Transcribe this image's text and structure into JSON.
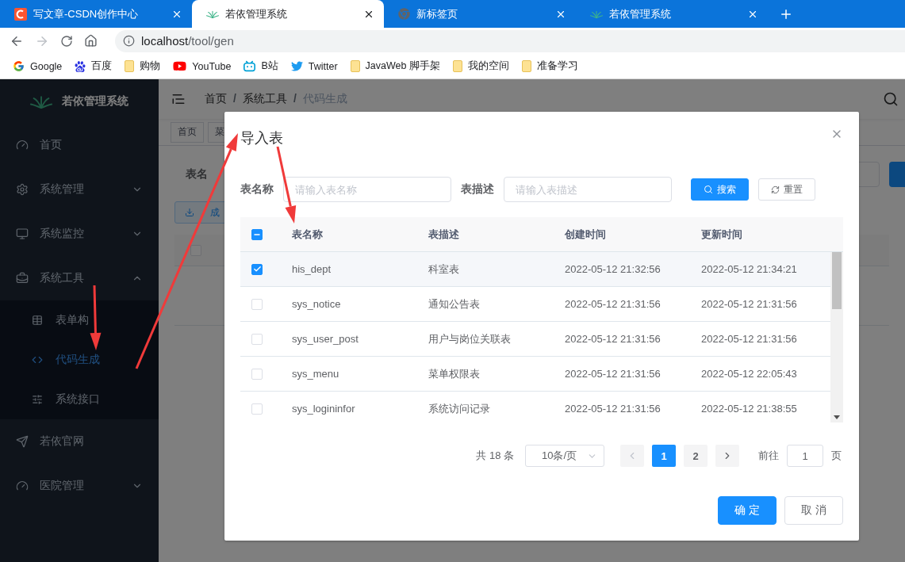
{
  "browser": {
    "tabs": [
      {
        "title": "写文章-CSDN创作中心",
        "kind": "csdn",
        "selected": false
      },
      {
        "title": "若依管理系统",
        "kind": "leaf",
        "selected": true
      },
      {
        "title": "新标签页",
        "kind": "chrome",
        "selected": false
      },
      {
        "title": "若依管理系统",
        "kind": "leaf",
        "selected": false
      }
    ],
    "address": {
      "host": "localhost",
      "path": "/tool/gen"
    },
    "bookmarks": [
      {
        "label": "Google",
        "kind": "google"
      },
      {
        "label": "百度",
        "kind": "baidu"
      },
      {
        "label": "购物",
        "kind": "folder"
      },
      {
        "label": "YouTube",
        "kind": "youtube"
      },
      {
        "label": "B站",
        "kind": "bilibili"
      },
      {
        "label": "Twitter",
        "kind": "twitter"
      },
      {
        "label": "JavaWeb 脚手架",
        "kind": "folder"
      },
      {
        "label": "我的空间",
        "kind": "folder"
      },
      {
        "label": "准备学习",
        "kind": "folder"
      }
    ]
  },
  "sidebar": {
    "title": "若依管理系统",
    "items": [
      {
        "label": "首页",
        "kind": "dashboard"
      },
      {
        "label": "系统管理",
        "kind": "gear",
        "expanded": false
      },
      {
        "label": "系统监控",
        "kind": "monitor",
        "expanded": false
      },
      {
        "label": "系统工具",
        "kind": "toolbox",
        "expanded": true,
        "children": [
          {
            "label": "表单构",
            "kind": "table",
            "selected": false
          },
          {
            "label": "代码生成",
            "kind": "code",
            "selected": true
          },
          {
            "label": "系统接口",
            "kind": "sliders",
            "selected": false
          }
        ]
      },
      {
        "label": "若依官网",
        "kind": "send"
      },
      {
        "label": "医院管理",
        "kind": "dashboard",
        "expanded": false
      }
    ]
  },
  "main": {
    "breadcrumb": [
      "首页",
      "系统工具",
      "代码生成"
    ],
    "breadcrumb_separator": "/",
    "tags": [
      "首页",
      "菜"
    ],
    "query_label": "表名",
    "generate_button": "成",
    "select_all_checked": false
  },
  "dialog": {
    "title": "导入表",
    "filters": [
      {
        "label": "表名称",
        "placeholder": "请输入表名称"
      },
      {
        "label": "表描述",
        "placeholder": "请输入表描述"
      }
    ],
    "search_button": "搜索",
    "reset_button": "重置",
    "table": {
      "header_indeterminate": true,
      "columns": [
        "表名称",
        "表描述",
        "创建时间",
        "更新时间"
      ],
      "rows": [
        {
          "checked": true,
          "cells": [
            "his_dept",
            "科室表",
            "2022-05-12 21:32:56",
            "2022-05-12 21:34:21"
          ]
        },
        {
          "checked": false,
          "cells": [
            "sys_notice",
            "通知公告表",
            "2022-05-12 21:31:56",
            "2022-05-12 21:31:56"
          ]
        },
        {
          "checked": false,
          "cells": [
            "sys_user_post",
            "用户与岗位关联表",
            "2022-05-12 21:31:56",
            "2022-05-12 21:31:56"
          ]
        },
        {
          "checked": false,
          "cells": [
            "sys_menu",
            "菜单权限表",
            "2022-05-12 21:31:56",
            "2022-05-12 22:05:43"
          ]
        },
        {
          "checked": false,
          "cells": [
            "sys_logininfor",
            "系统访问记录",
            "2022-05-12 21:31:56",
            "2022-05-12 21:38:55"
          ]
        }
      ]
    },
    "pagination": {
      "total": "共 18 条",
      "page_size": "10条/页",
      "pages": [
        {
          "label": "1",
          "selected": true
        },
        {
          "label": "2",
          "selected": false
        }
      ],
      "goto_label": "前往",
      "goto_value": "1",
      "page_unit": "页"
    },
    "buttons": [
      {
        "label": "确 定",
        "kind": "primary"
      },
      {
        "label": "取 消",
        "kind": "plain"
      }
    ]
  }
}
